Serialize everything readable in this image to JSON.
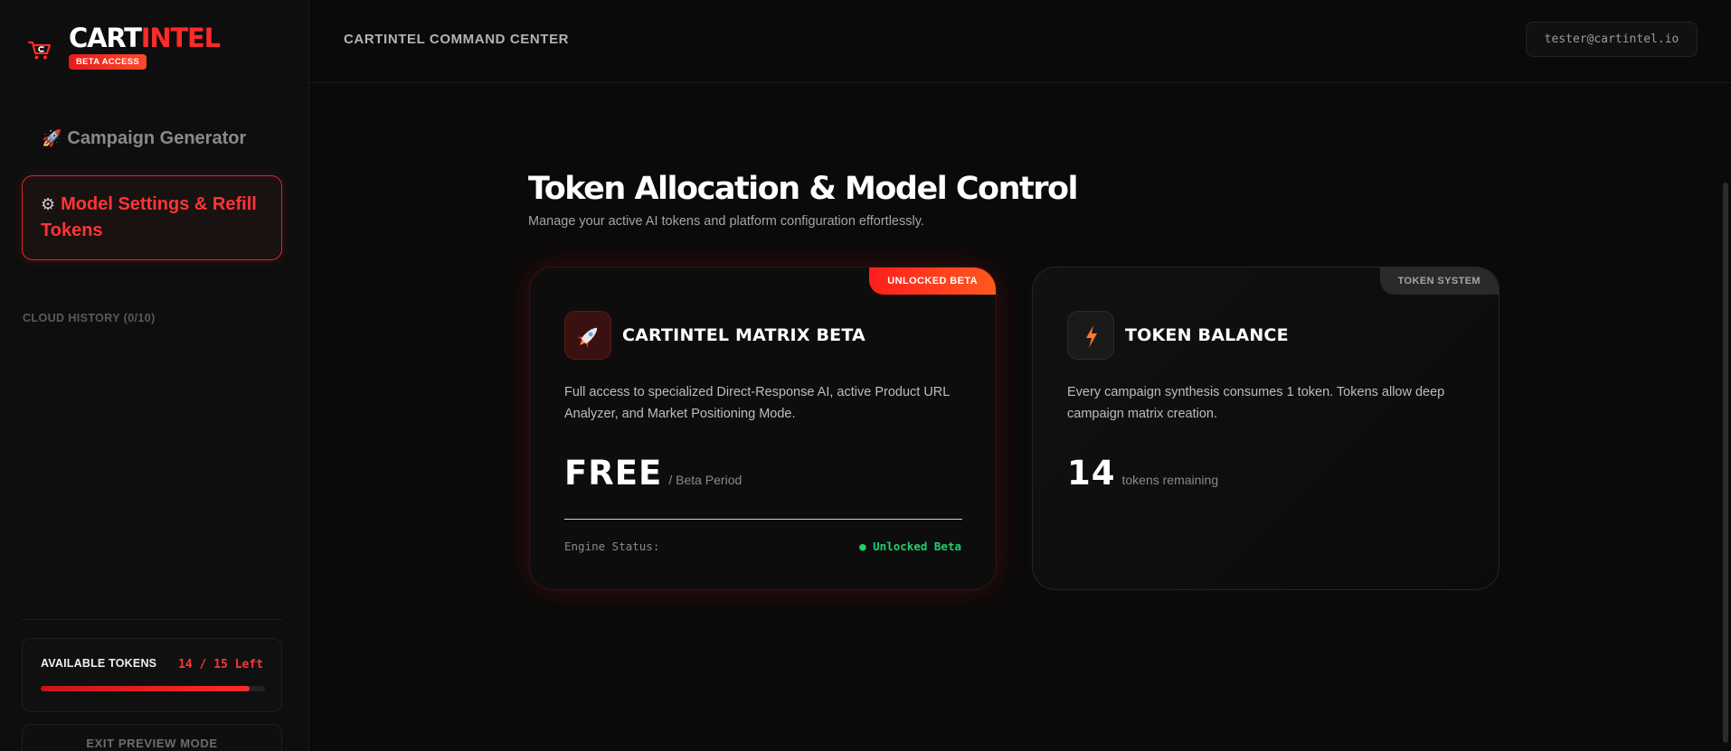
{
  "brand": {
    "name_part1": "CART",
    "name_part2": "INTEL",
    "badge": "BETA ACCESS",
    "accent_color": "#ff2a2a"
  },
  "sidebar": {
    "nav": [
      {
        "icon": "rocket-icon",
        "label": "Campaign Generator",
        "active": false
      },
      {
        "icon": "gear-icon",
        "label": "Model Settings & Refill Tokens",
        "active": true
      }
    ],
    "history_title": "CLOUD HISTORY (0/10)",
    "tokens": {
      "label": "AVAILABLE TOKENS",
      "count_text": "14 / 15 Left",
      "used": 14,
      "total": 15
    },
    "exit_label": "EXIT PREVIEW MODE"
  },
  "header": {
    "title": "CARTINTEL COMMAND CENTER",
    "user_email": "tester@cartintel.io"
  },
  "main": {
    "title": "Token Allocation & Model Control",
    "subtitle": "Manage your active AI tokens and platform configuration effortlessly.",
    "cards": {
      "matrix": {
        "ribbon": "UNLOCKED BETA",
        "icon": "rocket-icon",
        "title": "CARTINTEL MATRIX BETA",
        "desc": "Full access to specialized Direct-Response AI, active Product URL Analyzer, and Market Positioning Mode.",
        "price": "FREE",
        "price_note": "/ Beta Period",
        "status_label": "Engine Status:",
        "status_value": "● Unlocked Beta",
        "status_color": "#1fd06b"
      },
      "token": {
        "ribbon": "TOKEN SYSTEM",
        "icon": "lightning-icon",
        "title": "TOKEN BALANCE",
        "desc": "Every campaign synthesis consumes 1 token. Tokens allow deep campaign matrix creation.",
        "amount": "14",
        "amount_note": "tokens remaining"
      }
    }
  }
}
